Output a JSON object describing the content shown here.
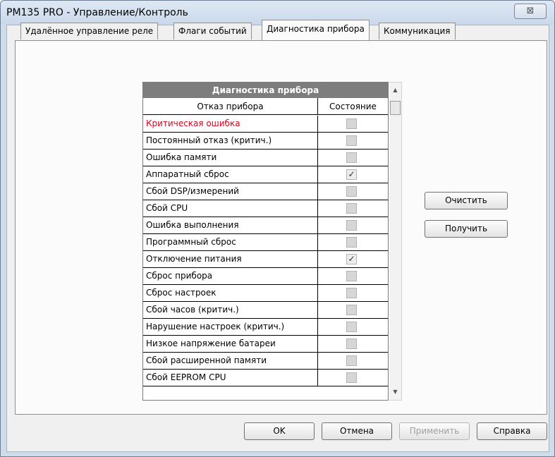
{
  "window": {
    "title": "PM135 PRO - Управление/Контроль",
    "close_glyph": "⊠"
  },
  "tabs": [
    {
      "label": "Удалённое управление реле"
    },
    {
      "label": "Флаги событий"
    },
    {
      "label": "Диагностика прибора",
      "active": true
    },
    {
      "label": "Коммуникация"
    }
  ],
  "grid": {
    "title": "Диагностика прибора",
    "col1": "Отказ прибора",
    "col2": "Состояние",
    "rows": [
      {
        "label": "Критическая ошибка",
        "checked": false,
        "highlight": true
      },
      {
        "label": "Постоянный отказ (критич.)",
        "checked": false
      },
      {
        "label": "Ошибка памяти",
        "checked": false
      },
      {
        "label": "Аппаратный сброс",
        "checked": true
      },
      {
        "label": "Сбой DSP/измерений",
        "checked": false
      },
      {
        "label": "Сбой CPU",
        "checked": false
      },
      {
        "label": "Ошибка выполнения",
        "checked": false
      },
      {
        "label": "Программный сброс",
        "checked": false
      },
      {
        "label": "Отключение питания",
        "checked": true
      },
      {
        "label": "Сброс прибора",
        "checked": false
      },
      {
        "label": "Сброс настроек",
        "checked": false
      },
      {
        "label": "Сбой часов (критич.)",
        "checked": false
      },
      {
        "label": "Нарушение настроек (критич.)",
        "checked": false
      },
      {
        "label": "Низкое напряжение батареи",
        "checked": false
      },
      {
        "label": "Сбой расширенной памяти",
        "checked": false
      },
      {
        "label": "Сбой EEPROM CPU",
        "checked": false
      }
    ],
    "highlight_color": "#e0001b"
  },
  "side_buttons": {
    "clear": "Очистить",
    "get": "Получить"
  },
  "footer": {
    "ok": "OK",
    "cancel": "Отмена",
    "apply": "Применить",
    "help": "Справка"
  },
  "checkmark": "✓",
  "scroll": {
    "up": "▲",
    "down": "▼"
  }
}
